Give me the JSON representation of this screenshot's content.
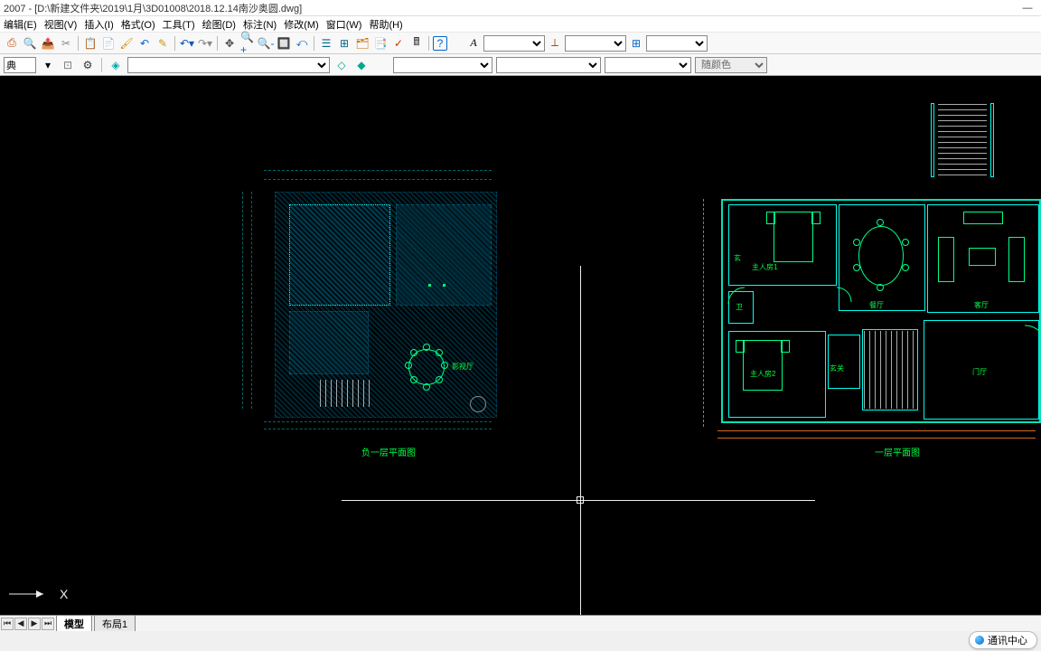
{
  "title": "2007 - [D:\\新建文件夹\\2019\\1月\\3D01008\\2018.12.14南沙奥圆.dwg]",
  "menu": {
    "edit": "编辑(E)",
    "view": "视图(V)",
    "insert": "插入(I)",
    "format": "格式(O)",
    "tools": "工具(T)",
    "draw": "绘图(D)",
    "dimension": "标注(N)",
    "modify": "修改(M)",
    "window": "窗口(W)",
    "help": "帮助(H)"
  },
  "toolbar2": {
    "style_combo_value": "典",
    "bycolor": "随颜色"
  },
  "tabs": {
    "model": "模型",
    "layout1": "布局1"
  },
  "status": {
    "comm": "通讯中心"
  },
  "labels": {
    "left_plan": "负一层平面图",
    "right_plan": "一层平面图"
  },
  "rooms": {
    "master1": "主人房1",
    "master2": "主人房2",
    "dining": "餐厅",
    "living": "客厅",
    "foyer": "门厅",
    "xuan": "玄",
    "wei": "卫",
    "xuanguan": "玄关",
    "studio": "影视厅"
  }
}
